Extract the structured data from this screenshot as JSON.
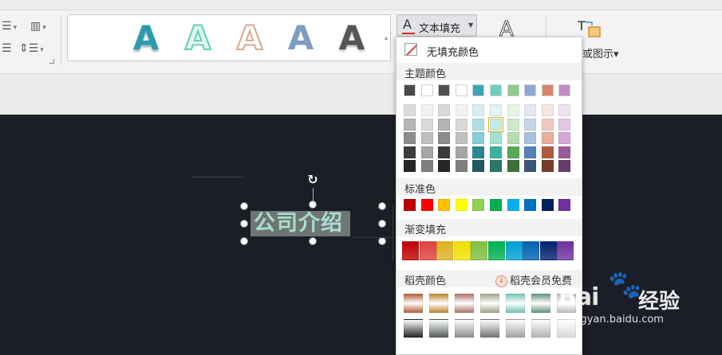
{
  "toolbar": {
    "fill_button_label": "文本填充",
    "fill_icon_glyph": "A",
    "outline_icon_glyph": "A",
    "shape_label": "或图示",
    "shape_dropdown": "▾",
    "gallery_glyph": "A"
  },
  "canvas": {
    "selected_text": "公司介绍",
    "rotate_glyph": "↻"
  },
  "menu": {
    "no_fill_label": "无填充颜色",
    "theme_heading": "主题颜色",
    "standard_heading": "标准色",
    "gradient_heading": "渐变填充",
    "docer_heading": "稻壳颜色",
    "docer_promo": "稻壳会员免费",
    "theme_top": [
      "#4a4a4a",
      "#ffffff",
      "#4f4f4f",
      "#ffffff",
      "#3aa6b6",
      "#6ccfbd",
      "#8fcb8a",
      "#8ea8cf",
      "#d9826b",
      "#c48ac4"
    ],
    "theme_shades": [
      [
        "#dcdcdc",
        "#f2f2f2",
        "#d9d9d9",
        "#f2f2f2",
        "#d8eef2",
        "#e0f5f1",
        "#e6f4e4",
        "#e3eaf4",
        "#f7e4df",
        "#f1e2f1"
      ],
      [
        "#b5b5b5",
        "#d9d9d9",
        "#b3b3b3",
        "#d9d9d9",
        "#afdee6",
        "#c1ebe3",
        "#cde9ca",
        "#c7d5ea",
        "#efc9bf",
        "#e3c6e3"
      ],
      [
        "#8c8c8c",
        "#bfbfbf",
        "#8c8c8c",
        "#bfbfbf",
        "#88cdd9",
        "#a3e1d5",
        "#b4deaf",
        "#aac0e0",
        "#e7ae9f",
        "#d5a9d5"
      ],
      [
        "#3d3d3d",
        "#a6a6a6",
        "#3b3b3b",
        "#a6a6a6",
        "#2d8593",
        "#3fb09b",
        "#5aa855",
        "#5a80b4",
        "#b15a43",
        "#9b5a9b"
      ],
      [
        "#262626",
        "#7f7f7f",
        "#262626",
        "#7f7f7f",
        "#1e5a63",
        "#2a7768",
        "#3d7139",
        "#3c5679",
        "#773c2d",
        "#683c68"
      ]
    ],
    "standard": [
      "#c00000",
      "#ff0000",
      "#ffc000",
      "#ffff00",
      "#92d050",
      "#00b050",
      "#00b0f0",
      "#0070c0",
      "#002060",
      "#7030a0"
    ],
    "gradient": [
      "#c00000",
      "#e04040",
      "#e0b020",
      "#f0e000",
      "#80c040",
      "#00b050",
      "#00a0d0",
      "#0060b0",
      "#002070",
      "#7030a0"
    ],
    "docer_row1": [
      "#b8663f",
      "#c48a3a",
      "#b07a70",
      "#a8a890",
      "#7ac8b8",
      "#6a9a80",
      "#c0c0c0"
    ],
    "docer_row2": [
      "#202020",
      "#505a5a",
      "#8a8a90",
      "#707070",
      "#a0a0a0",
      "#b0b0b0",
      "#d8d8d8"
    ]
  },
  "watermark": {
    "logo": "Bai",
    "paw": "🐾",
    "jingyan": "经验",
    "url": "jingyan.baidu.com"
  }
}
